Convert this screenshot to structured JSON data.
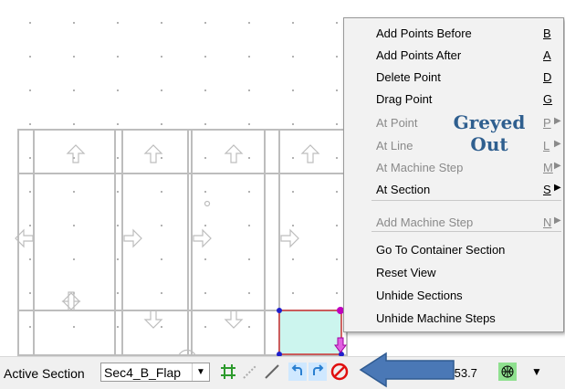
{
  "toolbar": {
    "active_section_label": "Active Section",
    "active_section_value": "Sec4_B_Flap",
    "readout": ".53.7",
    "icons": [
      "grid-icon",
      "dotted-line-icon",
      "line-icon",
      "undo-icon",
      "redo-icon",
      "cancel-icon",
      "globe-icon",
      "dropdown-arrow-icon"
    ]
  },
  "menu": {
    "items": [
      {
        "label": "Add Points Before",
        "accel": "B",
        "disabled": false
      },
      {
        "label": "Add Points After",
        "accel": "A",
        "disabled": false
      },
      {
        "label": "Delete Point",
        "accel": "D",
        "disabled": false
      },
      {
        "label": "Drag Point",
        "accel": "G",
        "disabled": false
      },
      {
        "label": "At Point",
        "accel": "P",
        "disabled": true,
        "submenu": true
      },
      {
        "label": "At Line",
        "accel": "L",
        "disabled": true,
        "submenu": true
      },
      {
        "label": "At Machine Step",
        "accel": "M",
        "disabled": true,
        "submenu": true
      },
      {
        "label": "At Section",
        "accel": "S",
        "disabled": false,
        "submenu": true
      },
      {
        "label": "Add Machine Step",
        "accel": "N",
        "disabled": true,
        "submenu": true
      },
      {
        "label": "Go To Container Section",
        "accel": "",
        "disabled": false
      },
      {
        "label": "Reset View",
        "accel": "",
        "disabled": false
      },
      {
        "label": "Unhide Sections",
        "accel": "",
        "disabled": false
      },
      {
        "label": "Unhide Machine Steps",
        "accel": "",
        "disabled": false
      }
    ]
  },
  "annotation": {
    "line1": "Greyed",
    "line2": "Out",
    "brace": "{",
    "color": "#2f5f8f",
    "arrow_color": "#3b6fb0"
  },
  "colors": {
    "selection_fill": "#ccf5ee",
    "selection_border": "#cc3333",
    "grid_line": "#bdbdbd"
  }
}
